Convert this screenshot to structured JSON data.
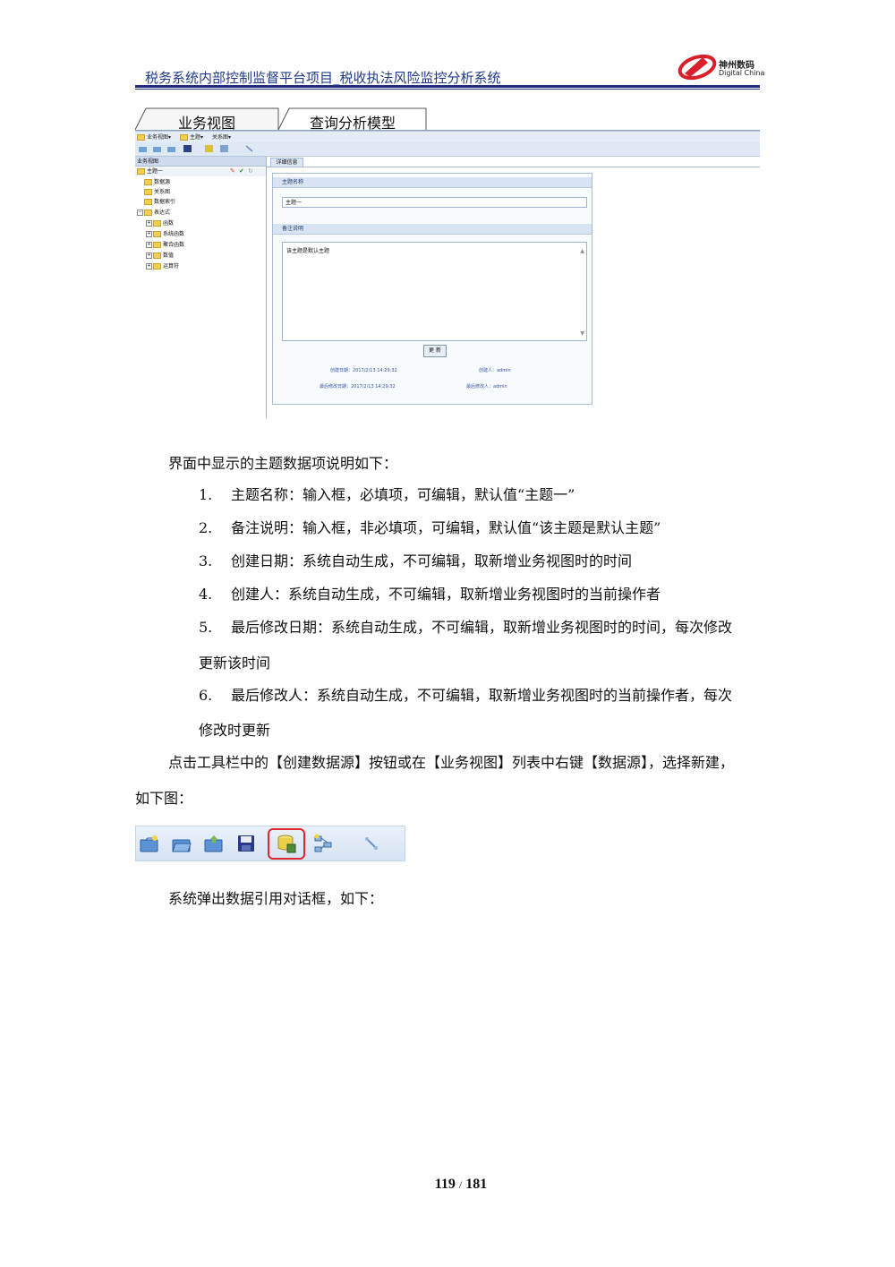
{
  "header": {
    "title": "税务系统内部控制监督平台项目_税收执法风险监控分析系统",
    "logo_cn": "神州数码",
    "logo_en": "Digital China"
  },
  "screenshot1": {
    "tabs": [
      "业务视图",
      "查询分析模型"
    ],
    "menu": [
      "业务视图▾",
      "主题▾",
      "关系图▾"
    ],
    "left_panel_title": "业务视图",
    "tree": {
      "root": "主题一",
      "children": [
        "数据源",
        "关系图",
        "数据索引"
      ],
      "expr_node": "表达式",
      "expr_children": [
        "函数",
        "系统函数",
        "聚合函数",
        "数值",
        "运算符"
      ]
    },
    "detail_tab": "详细信息",
    "form": {
      "name_section": "主题名称",
      "name_value": "主题一",
      "note_section": "备注说明",
      "note_value": "该主题是默认主题",
      "update_button": "更 新",
      "created_date": "创建日期：2017/2/13 14:29:32",
      "creator": "创建人：admin",
      "modified_date": "最后修改日期：2017/2/13 14:29:32",
      "modifier": "最后修改人：admin"
    }
  },
  "body": {
    "intro": "界面中显示的主题数据项说明如下：",
    "items": [
      {
        "num": "1.",
        "text": "主题名称：输入框，必填项，可编辑，默认值“主题一”"
      },
      {
        "num": "2.",
        "text": "备注说明：输入框，非必填项，可编辑，默认值“该主题是默认主题”"
      },
      {
        "num": "3.",
        "text": "创建日期：系统自动生成，不可编辑，取新增业务视图时的时间"
      },
      {
        "num": "4.",
        "text": "创建人：系统自动生成，不可编辑，取新增业务视图时的当前操作者"
      },
      {
        "num": "5.",
        "text": "最后修改日期：系统自动生成，不可编辑，取新增业务视图时的时间，每次修改",
        "cont": "更新该时间"
      },
      {
        "num": "6.",
        "text": "最后修改人：系统自动生成，不可编辑，取新增业务视图时的当前操作者，每次",
        "cont": "修改时更新"
      }
    ],
    "para_click": "点击工具栏中的【创建数据源】按钮或在【业务视图】列表中右键【数据源】，选择新建，",
    "para_click_cont": "如下图：",
    "para_dialog": "系统弹出数据引用对话框，如下："
  },
  "page": {
    "current": "119",
    "separator": "/",
    "total": "181"
  }
}
